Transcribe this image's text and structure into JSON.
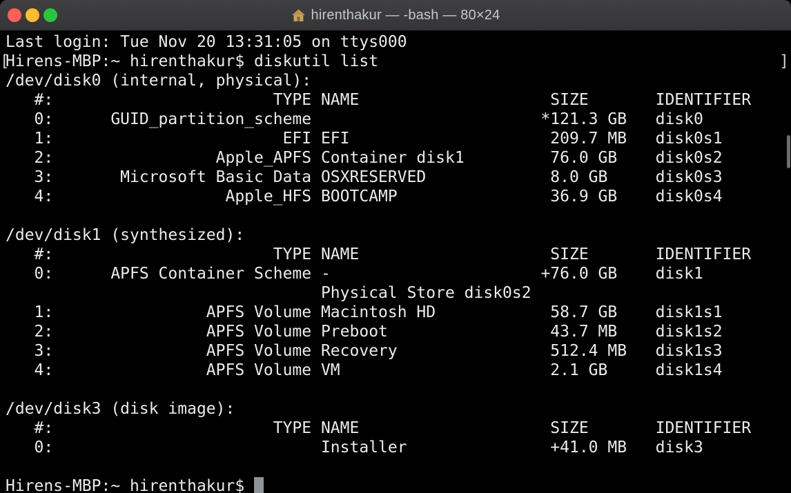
{
  "window": {
    "title": "hirenthakur — -bash — 80×24",
    "traffic_lights": {
      "close_color": "#ff5f57",
      "minimize_color": "#febc2e",
      "zoom_color": "#29c73f"
    }
  },
  "colors": {
    "terminal_background": "#000000",
    "terminal_text": "#ebebeb",
    "titlebar_background": "#3a3a3c",
    "cursor": "#8f9296"
  },
  "terminal": {
    "mark_open": "[",
    "mark_close": "]",
    "lines": [
      "Last login: Tue Nov 20 13:31:05 on ttys000",
      "Hirens-MBP:~ hirenthakur$ diskutil list",
      "/dev/disk0 (internal, physical):",
      "   #:                       TYPE NAME                    SIZE       IDENTIFIER",
      "   0:      GUID_partition_scheme                        *121.3 GB   disk0",
      "   1:                        EFI EFI                     209.7 MB   disk0s1",
      "   2:                 Apple_APFS Container disk1         76.0 GB    disk0s2",
      "   3:       Microsoft Basic Data OSXRESERVED             8.0 GB     disk0s3",
      "   4:                  Apple_HFS BOOTCAMP                36.9 GB    disk0s4",
      "",
      "/dev/disk1 (synthesized):",
      "   #:                       TYPE NAME                    SIZE       IDENTIFIER",
      "   0:      APFS Container Scheme -                      +76.0 GB    disk1",
      "                                 Physical Store disk0s2",
      "   1:                APFS Volume Macintosh HD            58.7 GB    disk1s1",
      "   2:                APFS Volume Preboot                 43.7 MB    disk1s2",
      "   3:                APFS Volume Recovery                512.4 MB   disk1s3",
      "   4:                APFS Volume VM                      2.1 GB     disk1s4",
      "",
      "/dev/disk3 (disk image):",
      "   #:                       TYPE NAME                    SIZE       IDENTIFIER",
      "   0:                            Installer               +41.0 MB   disk3",
      ""
    ],
    "prompt": "Hirens-MBP:~ hirenthakur$ "
  }
}
